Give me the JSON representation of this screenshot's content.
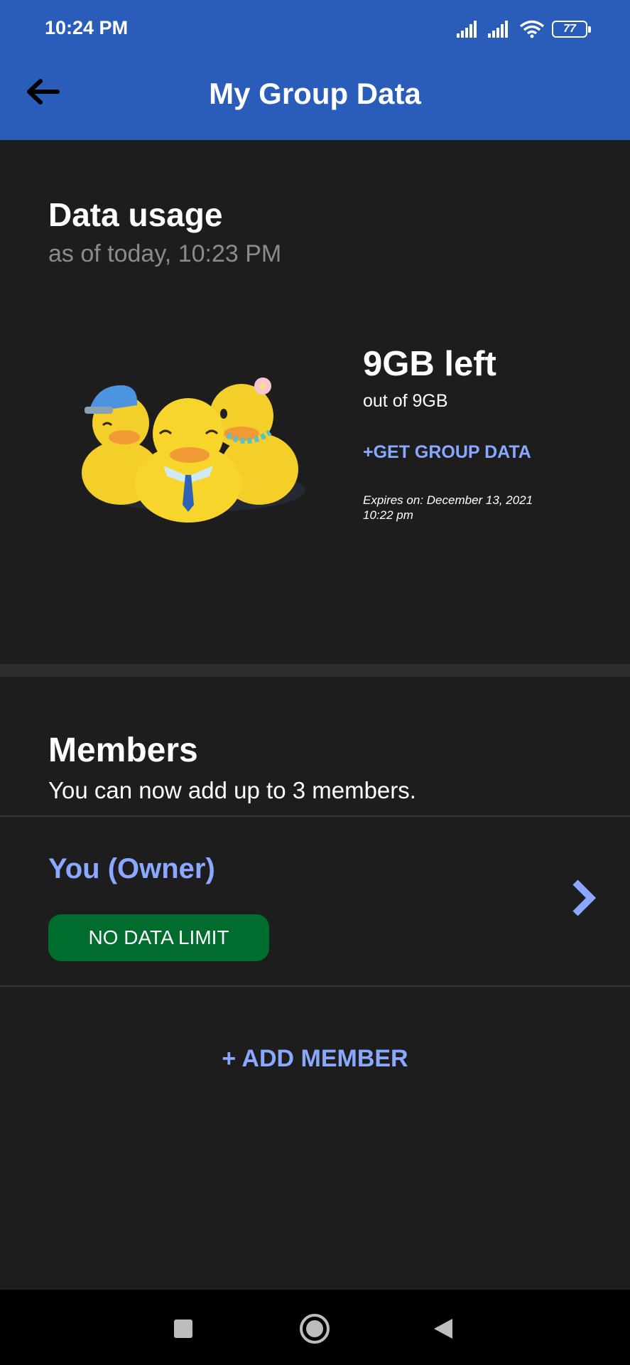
{
  "status_bar": {
    "time": "10:24 PM",
    "battery": "77",
    "icons": [
      "signal-icon",
      "signal-icon",
      "wifi-icon",
      "battery-icon"
    ]
  },
  "app_bar": {
    "title": "My Group Data",
    "back_icon": "arrow-left-icon"
  },
  "data_usage": {
    "title": "Data usage",
    "as_of": "as of today, 10:23 PM",
    "remaining": "9GB left",
    "total": "out of 9GB",
    "get_more": "+GET GROUP DATA",
    "expires_line1": "Expires on: December 13, 2021",
    "expires_line2": "10:22 pm",
    "illustration": "ducks-illustration"
  },
  "members": {
    "title": "Members",
    "subtitle": "You can now add up to 3 members.",
    "list": [
      {
        "name": "You (Owner)",
        "badge": "NO DATA LIMIT",
        "icon": "chevron-right-icon"
      }
    ],
    "add_label": "+ ADD MEMBER"
  },
  "colors": {
    "app_bar": "#2a5cba",
    "background": "#1d1d1e",
    "accent": "#8aa8ff",
    "badge": "#006c2e"
  },
  "nav_bar": {
    "items": [
      "recent-apps-icon",
      "home-icon",
      "back-triangle-icon"
    ]
  }
}
